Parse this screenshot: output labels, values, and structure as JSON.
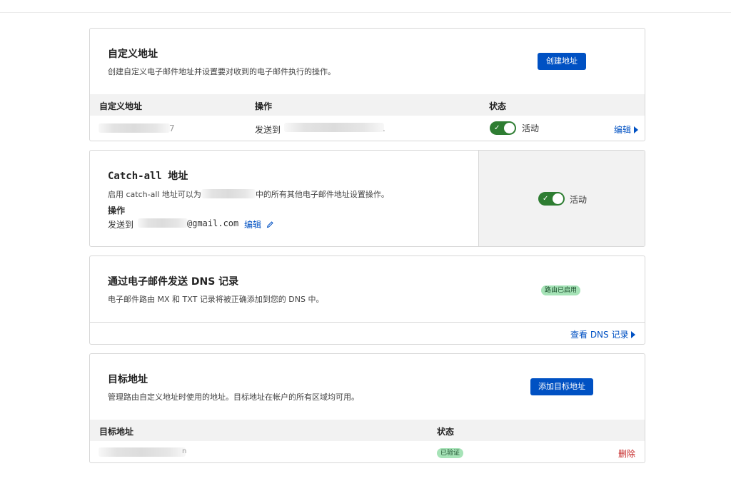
{
  "custom_addresses": {
    "title": "自定义地址",
    "description": "创建自定义电子邮件地址并设置要对收到的电子邮件执行的操作。",
    "create_button": "创建地址",
    "columns": [
      "自定义地址",
      "操作",
      "状态"
    ],
    "rows": [
      {
        "address_tail": "7",
        "action_prefix": "发送到",
        "action_tail": ".",
        "status_label": "活动",
        "edit_label": "编辑"
      }
    ]
  },
  "catch_all": {
    "title": "Catch-all 地址",
    "description_prefix": "启用 catch-all 地址可以为",
    "description_suffix": "中的所有其他电子邮件地址设置操作。",
    "action_heading": "操作",
    "action_prefix": "发送到",
    "action_email_suffix": "@gmail.com",
    "edit_label": "编辑",
    "status_label": "活动"
  },
  "dns": {
    "title": "通过电子邮件发送 DNS 记录",
    "description": "电子邮件路由 MX 和 TXT 记录将被正确添加到您的 DNS 中。",
    "badge": "路由已启用",
    "view_link": "查看 DNS 记录"
  },
  "destinations": {
    "title": "目标地址",
    "description": "管理路由自定义地址时使用的地址。目标地址在帐户的所有区域均可用。",
    "add_button": "添加目标地址",
    "columns": [
      "目标地址",
      "状态"
    ],
    "rows": [
      {
        "address_tail": "n",
        "status_badge": "已验证",
        "delete_label": "删除"
      }
    ]
  },
  "colors": {
    "accent": "#0051c3",
    "toggle_on": "#2e7d32",
    "badge_green": "#a6e3b7",
    "danger": "#c62828"
  }
}
